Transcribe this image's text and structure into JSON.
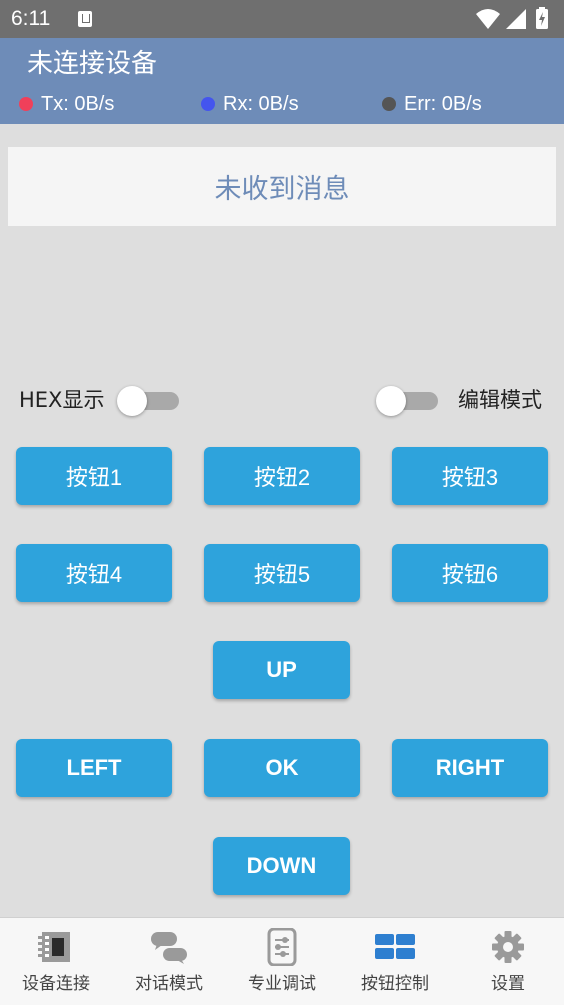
{
  "status_bar": {
    "time": "6:11",
    "icons": [
      "notification-icon",
      "wifi-icon",
      "cell-signal-icon",
      "battery-icon"
    ]
  },
  "header": {
    "title": "未连接设备",
    "tx": {
      "label": "Tx: 0B/s",
      "color": "#f0405a"
    },
    "rx": {
      "label": "Rx: 0B/s",
      "color": "#4455ee"
    },
    "err": {
      "label": "Err: 0B/s",
      "color": "#555555"
    },
    "background": "#6e8cb8"
  },
  "message": {
    "text": "未收到消息"
  },
  "toggles": {
    "hex_label": "HEX显示",
    "hex_on": false,
    "edit_label": "编辑模式",
    "edit_on": false
  },
  "buttons": {
    "b1": "按钮1",
    "b2": "按钮2",
    "b3": "按钮3",
    "b4": "按钮4",
    "b5": "按钮5",
    "b6": "按钮6",
    "up": "UP",
    "left": "LEFT",
    "ok": "OK",
    "right": "RIGHT",
    "down": "DOWN",
    "color": "#2ea3dc"
  },
  "nav": {
    "items": [
      {
        "label": "设备连接",
        "icon": "device-chip-icon"
      },
      {
        "label": "对话模式",
        "icon": "chat-bubbles-icon"
      },
      {
        "label": "专业调试",
        "icon": "sliders-icon"
      },
      {
        "label": "按钮控制",
        "icon": "grid-buttons-icon"
      },
      {
        "label": "设置",
        "icon": "gear-icon"
      }
    ],
    "active_index": 3
  }
}
